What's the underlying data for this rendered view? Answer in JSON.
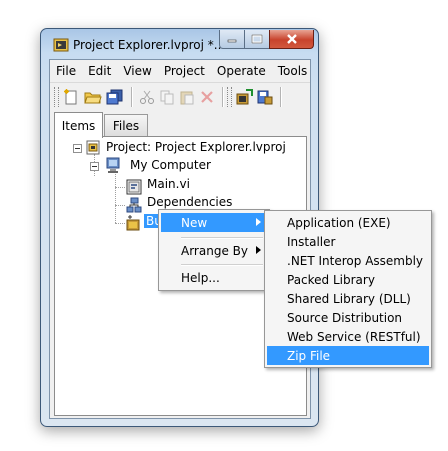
{
  "window": {
    "title": "Project Explorer.lvproj *..."
  },
  "menubar": [
    "File",
    "Edit",
    "View",
    "Project",
    "Operate",
    "Tools"
  ],
  "toolbar": {
    "icons": [
      "new-icon",
      "open-folder-icon",
      "save-all-icon",
      "cut-icon",
      "copy-icon",
      "paste-icon",
      "delete-icon",
      "build-icon",
      "deploy-icon"
    ]
  },
  "tabs": {
    "items": "Items",
    "files": "Files",
    "active": "Items"
  },
  "tree": {
    "project": "Project: Project Explorer.lvproj",
    "computer": "My Computer",
    "main_vi": "Main.vi",
    "dependencies": "Dependencies",
    "build_specs": "Build Specifications"
  },
  "context_menu": {
    "new": "New",
    "arrange_by": "Arrange By",
    "help": "Help..."
  },
  "submenu": {
    "items": [
      "Application (EXE)",
      "Installer",
      ".NET Interop Assembly",
      "Packed Library",
      "Shared Library (DLL)",
      "Source Distribution",
      "Web Service (RESTful)",
      "Zip File"
    ],
    "highlighted": "Zip File"
  },
  "colors": {
    "selection": "#3399ff",
    "close_button": "#c8432c",
    "title_bar": "#a9c6e6"
  }
}
